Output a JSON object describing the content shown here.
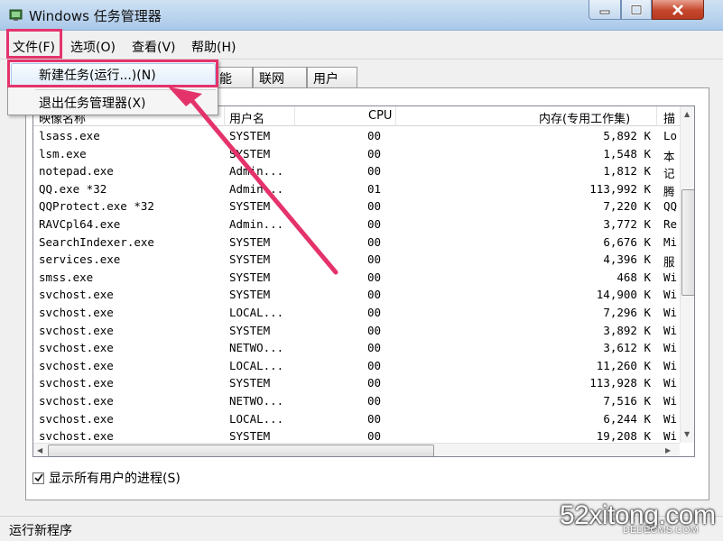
{
  "window": {
    "title": "Windows 任务管理器"
  },
  "menubar": {
    "items": [
      "文件(F)",
      "选项(O)",
      "查看(V)",
      "帮助(H)"
    ]
  },
  "file_menu": {
    "items": [
      "新建任务(运行...)(N)",
      "退出任务管理器(X)"
    ]
  },
  "tabs": [
    "能",
    "联网",
    "用户"
  ],
  "process_list": {
    "columns": [
      "映像名称",
      "用户名",
      "CPU",
      "内存(专用工作集)",
      "描"
    ],
    "rows": [
      {
        "name": "lsass.exe",
        "user": "SYSTEM",
        "cpu": "00",
        "mem": "5,892 K",
        "desc": "Lo"
      },
      {
        "name": "lsm.exe",
        "user": "SYSTEM",
        "cpu": "00",
        "mem": "1,548 K",
        "desc": "本"
      },
      {
        "name": "notepad.exe",
        "user": "Admin...",
        "cpu": "00",
        "mem": "1,812 K",
        "desc": "记"
      },
      {
        "name": "QQ.exe *32",
        "user": "Admin...",
        "cpu": "01",
        "mem": "113,992 K",
        "desc": "腾"
      },
      {
        "name": "QQProtect.exe *32",
        "user": "SYSTEM",
        "cpu": "00",
        "mem": "7,220 K",
        "desc": "QQ"
      },
      {
        "name": "RAVCpl64.exe",
        "user": "Admin...",
        "cpu": "00",
        "mem": "3,772 K",
        "desc": "Re"
      },
      {
        "name": "SearchIndexer.exe",
        "user": "SYSTEM",
        "cpu": "00",
        "mem": "6,676 K",
        "desc": "Mi"
      },
      {
        "name": "services.exe",
        "user": "SYSTEM",
        "cpu": "00",
        "mem": "4,396 K",
        "desc": "服"
      },
      {
        "name": "smss.exe",
        "user": "SYSTEM",
        "cpu": "00",
        "mem": "468 K",
        "desc": "Wi"
      },
      {
        "name": "svchost.exe",
        "user": "SYSTEM",
        "cpu": "00",
        "mem": "14,900 K",
        "desc": "Wi"
      },
      {
        "name": "svchost.exe",
        "user": "LOCAL...",
        "cpu": "00",
        "mem": "7,296 K",
        "desc": "Wi"
      },
      {
        "name": "svchost.exe",
        "user": "SYSTEM",
        "cpu": "00",
        "mem": "3,892 K",
        "desc": "Wi"
      },
      {
        "name": "svchost.exe",
        "user": "NETWO...",
        "cpu": "00",
        "mem": "3,612 K",
        "desc": "Wi"
      },
      {
        "name": "svchost.exe",
        "user": "LOCAL...",
        "cpu": "00",
        "mem": "11,260 K",
        "desc": "Wi"
      },
      {
        "name": "svchost.exe",
        "user": "SYSTEM",
        "cpu": "00",
        "mem": "113,928 K",
        "desc": "Wi"
      },
      {
        "name": "svchost.exe",
        "user": "NETWO...",
        "cpu": "00",
        "mem": "7,516 K",
        "desc": "Wi"
      },
      {
        "name": "svchost.exe",
        "user": "LOCAL...",
        "cpu": "00",
        "mem": "6,244 K",
        "desc": "Wi"
      },
      {
        "name": "svchost.exe",
        "user": "SYSTEM",
        "cpu": "00",
        "mem": "19,208 K",
        "desc": "Wi"
      }
    ]
  },
  "show_all_users": {
    "label": "显示所有用户的进程(S)",
    "checked": true
  },
  "statusbar": {
    "text": "运行新程序"
  },
  "watermark": {
    "main": "52xitong.com",
    "sub": "DEDECMS.COM"
  },
  "colors": {
    "annotation": "#e4336b"
  }
}
